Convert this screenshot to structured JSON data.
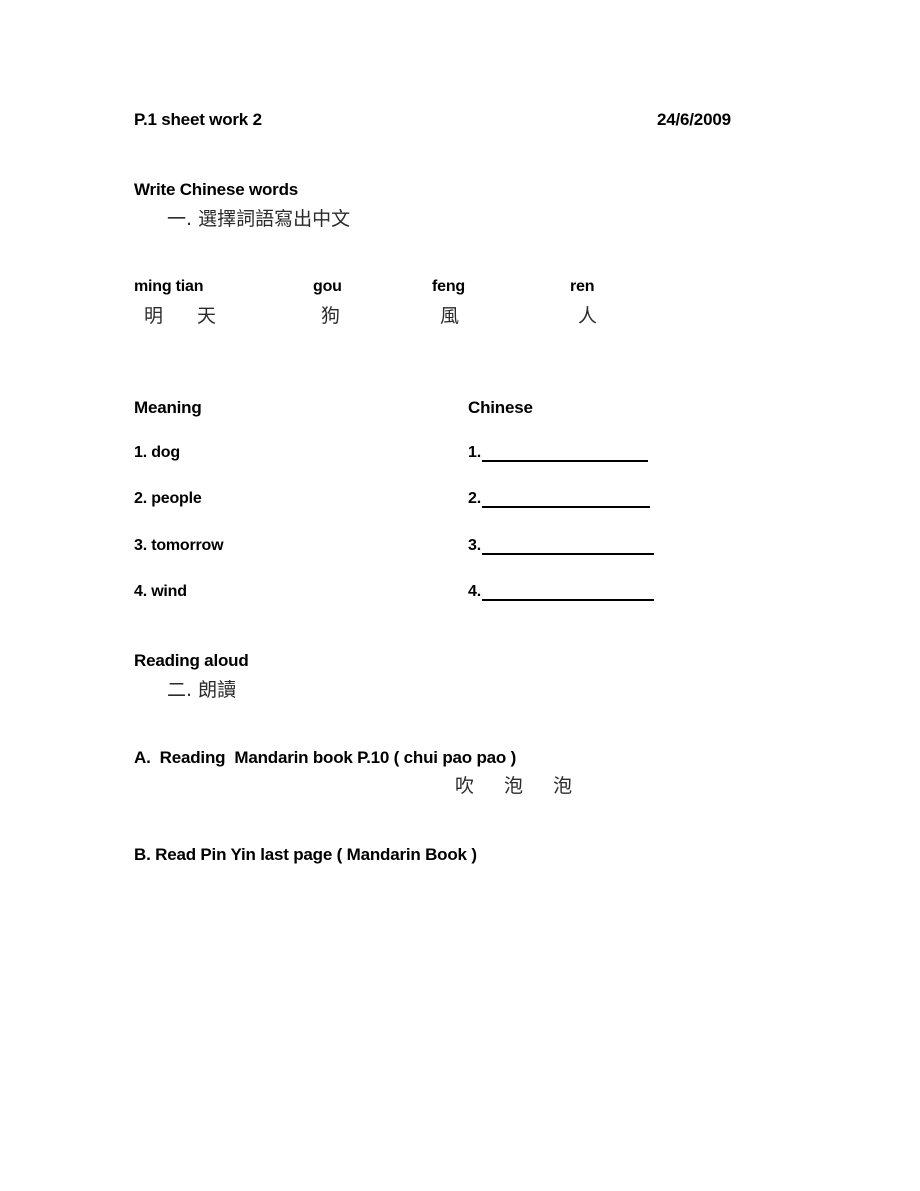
{
  "header": {
    "title": "P.1 sheet work 2",
    "date": "24/6/2009"
  },
  "section1": {
    "heading": "Write Chinese words",
    "instruction_cjk": "一. 選擇詞語寫出中文",
    "vocabulary": [
      {
        "pinyin": "ming tian",
        "hanzi": "明 天"
      },
      {
        "pinyin": "gou",
        "hanzi": "狗"
      },
      {
        "pinyin": "feng",
        "hanzi": "風"
      },
      {
        "pinyin": "ren",
        "hanzi": "人"
      }
    ],
    "table": {
      "columns": [
        "Meaning",
        "Chinese"
      ],
      "rows": [
        {
          "meaning": "1. dog",
          "answer_number": "1.",
          "answer_value": ""
        },
        {
          "meaning": "2. people",
          "answer_number": "2.",
          "answer_value": ""
        },
        {
          "meaning": "3. tomorrow",
          "answer_number": "3.",
          "answer_value": ""
        },
        {
          "meaning": "4. wind",
          "answer_number": "4.",
          "answer_value": ""
        }
      ]
    }
  },
  "section2": {
    "heading": "Reading aloud",
    "instruction_cjk": "二. 朗讀",
    "tasks": [
      {
        "label": "A.  Reading  Mandarin book P.10 ( chui pao pao )",
        "hanzi": "吹 泡 泡"
      },
      {
        "label": "B. Read Pin Yin last page ( Mandarin Book )",
        "hanzi": ""
      }
    ]
  },
  "colors": {
    "page_background": "#ffffff",
    "text": "#000000",
    "cjk_text": "#2b2b2b",
    "rule": "#000000"
  }
}
